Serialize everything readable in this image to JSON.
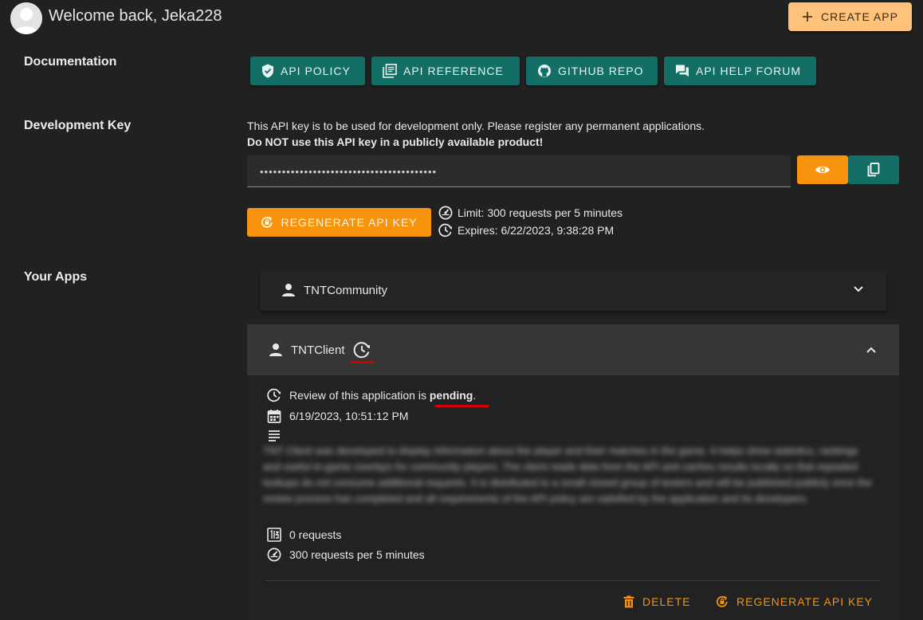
{
  "header": {
    "welcome": "Welcome back, Jeka228",
    "create_app_label": "CREATE APP"
  },
  "documentation": {
    "label": "Documentation",
    "buttons": [
      {
        "label": "API POLICY",
        "icon": "shield-check-icon"
      },
      {
        "label": "API REFERENCE",
        "icon": "library-books-icon"
      },
      {
        "label": "GITHUB REPO",
        "icon": "github-icon"
      },
      {
        "label": "API HELP FORUM",
        "icon": "forum-icon"
      }
    ]
  },
  "dev_key": {
    "label": "Development Key",
    "notice": "This API key is to be used for development only. Please register any permanent applications.",
    "warning": "Do NOT use this API key in a publicly available product!",
    "masked_value": "••••••••••••••••••••••••••••••••••••••••",
    "regenerate_label": "REGENERATE API KEY",
    "limit": "Limit: 300 requests per 5 minutes",
    "expires": "Expires: 6/22/2023, 9:38:28 PM"
  },
  "apps": {
    "label": "Your Apps",
    "items": [
      {
        "name": "TNTCommunity",
        "expanded": false
      },
      {
        "name": "TNTClient",
        "expanded": true,
        "review_prefix": "Review of this application is ",
        "review_status": "pending",
        "review_suffix": ".",
        "created": "6/19/2023, 10:51:12 PM",
        "description_blurred": "TNT Client was developed to display information about the player and their matches in the game. It helps show statistics, rankings and useful in-game overlays for community players. The client reads data from the API and caches results locally so that repeated lookups do not consume additional requests. It is distributed to a small closed group of testers and will be published publicly once the review process has completed and all requirements of the API policy are satisfied by the application and its developers.",
        "requests": "0 requests",
        "rate": "300 requests per 5 minutes",
        "delete_label": "DELETE",
        "regenerate_label": "REGENERATE API KEY"
      }
    ]
  },
  "colors": {
    "background": "#212121",
    "teal": "#136e65",
    "orange": "#f7930c",
    "create_button": "#ffc27a",
    "annotation_red": "#d40000"
  }
}
